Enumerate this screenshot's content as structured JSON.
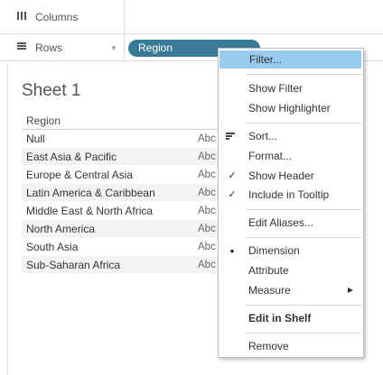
{
  "shelves": {
    "columns": {
      "label": "Columns",
      "icon": "columns-icon"
    },
    "rows": {
      "label": "Rows",
      "icon": "rows-icon",
      "pill": "Region"
    }
  },
  "sheet": {
    "title": "Sheet 1",
    "column_header": "Region",
    "rows": [
      {
        "region": "Null",
        "mark": "Abc"
      },
      {
        "region": "East Asia & Pacific",
        "mark": "Abc"
      },
      {
        "region": "Europe & Central Asia",
        "mark": "Abc"
      },
      {
        "region": "Latin America & Caribbean",
        "mark": "Abc"
      },
      {
        "region": "Middle East & North Africa",
        "mark": "Abc"
      },
      {
        "region": "North America",
        "mark": "Abc"
      },
      {
        "region": "South Asia",
        "mark": "Abc"
      },
      {
        "region": "Sub-Saharan Africa",
        "mark": "Abc"
      }
    ]
  },
  "menu": {
    "filter": "Filter...",
    "show_filter": "Show Filter",
    "show_highlighter": "Show Highlighter",
    "sort": "Sort...",
    "format": "Format...",
    "show_header": "Show Header",
    "include_tooltip": "Include in Tooltip",
    "edit_aliases": "Edit Aliases...",
    "dimension": "Dimension",
    "attribute": "Attribute",
    "measure": "Measure",
    "edit_in_shelf": "Edit in Shelf",
    "remove": "Remove",
    "highlight_color": "#99cbf0"
  },
  "colors": {
    "pill": "#3a7a99"
  }
}
